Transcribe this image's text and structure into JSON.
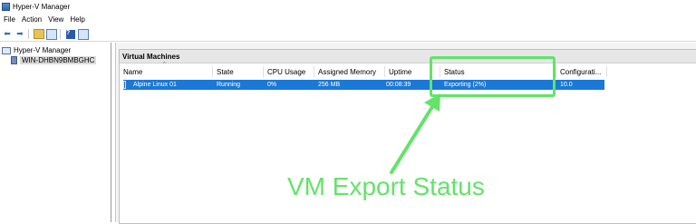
{
  "window": {
    "title": "Hyper-V Manager",
    "icon": "hyperv-app-icon"
  },
  "menu": {
    "items": [
      "File",
      "Action",
      "View",
      "Help"
    ]
  },
  "toolbar": {
    "buttons": [
      "back-icon",
      "forward-icon",
      "folder-icon",
      "grid-icon",
      "help-icon",
      "grid-icon"
    ]
  },
  "tree": {
    "root": "Hyper-V Manager",
    "server": "WIN-DHBN9BMBGHC"
  },
  "panel": {
    "title": "Virtual Machines"
  },
  "table": {
    "columns": [
      "Name",
      "State",
      "CPU Usage",
      "Assigned Memory",
      "Uptime",
      "Status",
      "Configurati..."
    ],
    "rows": [
      {
        "name": "Alpine Linux 01",
        "state": "Running",
        "cpu": "0%",
        "memory": "256 MB",
        "uptime": "00:08:39",
        "status": "Exporting (2%)",
        "config": "10.0"
      }
    ]
  },
  "annotation": {
    "text": "VM Export Status",
    "color": "#63e369"
  },
  "colors": {
    "selection": "#1a78d7",
    "highlight": "#63e369"
  }
}
